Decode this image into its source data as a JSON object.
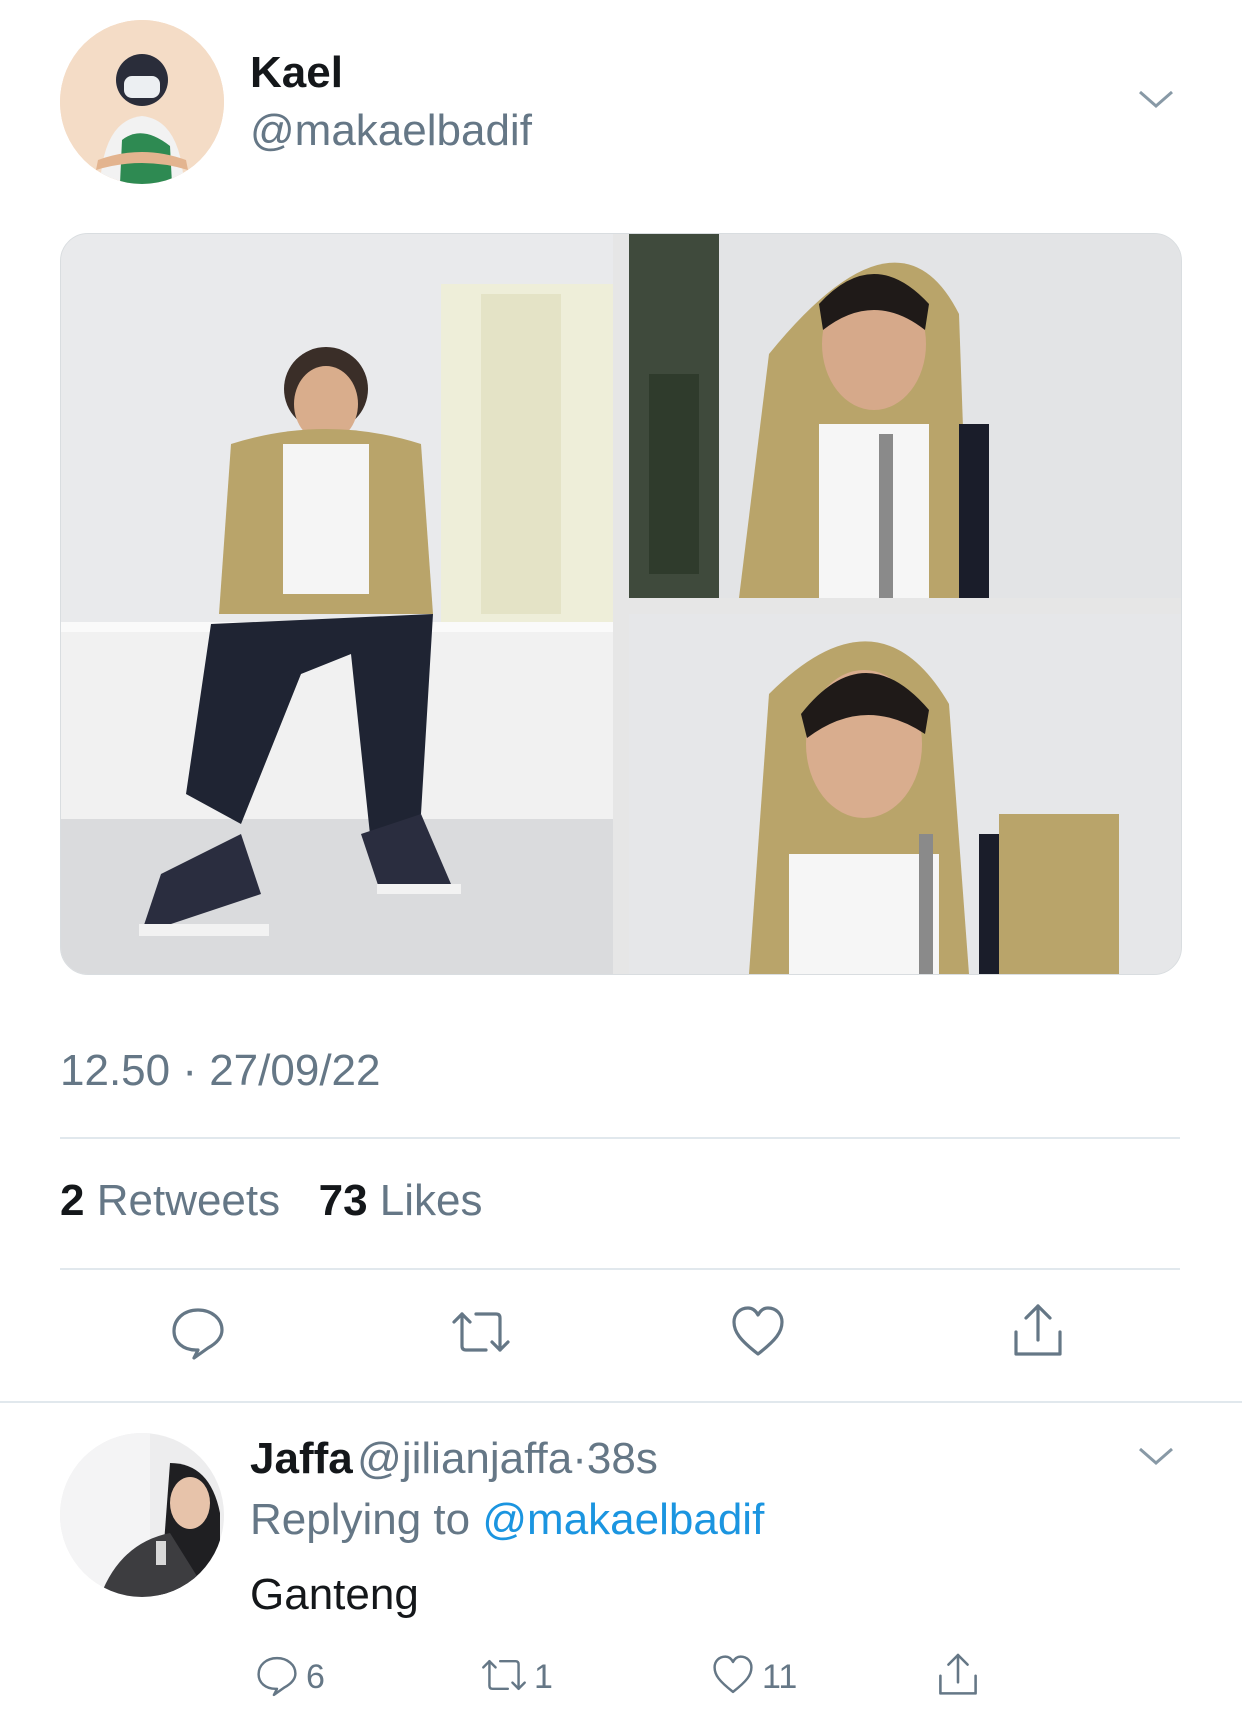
{
  "tweet": {
    "author_name": "Kael",
    "author_handle": "@makaelbadif",
    "timestamp": "12.50 · 27/09/22",
    "retweets_count": "2",
    "retweets_label": "Retweets",
    "likes_count": "73",
    "likes_label": "Likes",
    "media_count": 3,
    "actions": [
      "reply-icon",
      "retweet-icon",
      "like-icon",
      "share-icon"
    ]
  },
  "reply": {
    "author_name": "Jaffa",
    "author_handle": "@jilianjaffa",
    "age": "·38s",
    "replying_prefix": "Replying to",
    "replying_to": "@makaelbadif",
    "text": "Ganteng",
    "reply_count": "6",
    "retweet_count": "1",
    "like_count": "11"
  },
  "colors": {
    "link": "#1b95e0",
    "secondary_text": "#657786",
    "divider": "#e1e8ed",
    "jacket": "#b9a46a"
  }
}
